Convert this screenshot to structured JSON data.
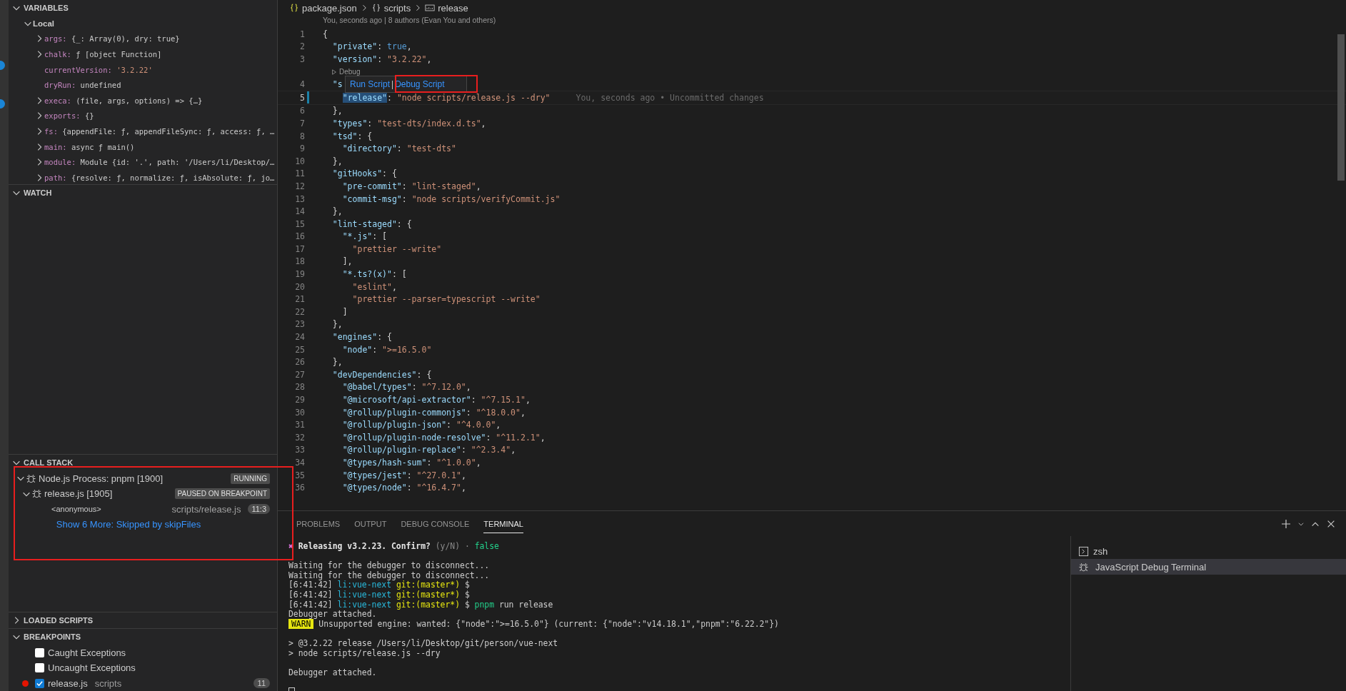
{
  "variables": {
    "title": "VARIABLES",
    "expanded": true,
    "scopes": [
      {
        "label": "Local",
        "expanded": true,
        "children": [
          {
            "name": "args:",
            "value": "{_: Array(0), dry: true}",
            "expandable": true,
            "kind": "object"
          },
          {
            "name": "chalk:",
            "value": "ƒ [object Function]",
            "expandable": true,
            "kind": "object"
          },
          {
            "name": "currentVersion:",
            "value": "'3.2.22'",
            "expandable": false,
            "kind": "string"
          },
          {
            "name": "dryRun:",
            "value": "undefined",
            "expandable": false,
            "kind": "object"
          },
          {
            "name": "execa:",
            "value": "(file, args, options) => {…}",
            "expandable": true,
            "kind": "object"
          },
          {
            "name": "exports:",
            "value": "{}",
            "expandable": true,
            "kind": "object"
          },
          {
            "name": "fs:",
            "value": "{appendFile: ƒ, appendFileSync: ƒ, access: ƒ, …",
            "expandable": true,
            "kind": "object"
          },
          {
            "name": "main:",
            "value": "async ƒ main()",
            "expandable": true,
            "kind": "object"
          },
          {
            "name": "module:",
            "value": "Module {id: '.', path: '/Users/li/Desktop/…",
            "expandable": true,
            "kind": "object"
          },
          {
            "name": "path:",
            "value": "{resolve: ƒ, normalize: ƒ, isAbsolute: ƒ, jo…",
            "expandable": true,
            "kind": "object"
          }
        ]
      }
    ]
  },
  "watch": {
    "title": "WATCH",
    "expanded": true
  },
  "call_stack": {
    "title": "CALL STACK",
    "expanded": true,
    "sessions": [
      {
        "label": "Node.js Process: pnpm [1900]",
        "status": "RUNNING",
        "expanded": true,
        "children": [
          {
            "label": "release.js [1905]",
            "status": "PAUSED ON BREAKPOINT",
            "expanded": true,
            "frames": [
              {
                "name": "<anonymous>",
                "file": "scripts/release.js",
                "position": "11:3"
              }
            ],
            "more": "Show 6 More: Skipped by skipFiles"
          }
        ]
      }
    ]
  },
  "loaded_scripts": {
    "title": "LOADED SCRIPTS",
    "expanded": false
  },
  "breakpoints": {
    "title": "BREAKPOINTS",
    "expanded": true,
    "items": [
      {
        "label": "Caught Exceptions",
        "checked": false,
        "kind": "exception"
      },
      {
        "label": "Uncaught Exceptions",
        "checked": false,
        "kind": "exception"
      },
      {
        "label": "release.js",
        "detail": "scripts",
        "count": "11",
        "checked": true,
        "kind": "file"
      }
    ]
  },
  "breadcrumb": [
    {
      "label": "package.json",
      "kind": "file"
    },
    {
      "label": "scripts",
      "kind": "object"
    },
    {
      "label": "release",
      "kind": "string"
    }
  ],
  "blame_header": "You, seconds ago | 8 authors (Evan You and others)",
  "hover_actions": {
    "items": [
      "Run Script",
      "Debug Script"
    ],
    "separator": "|"
  },
  "code": [
    {
      "kind": "code",
      "number": "1",
      "tokens": [
        {
          "kind": "punct",
          "text": "{"
        }
      ]
    },
    {
      "kind": "code",
      "number": "2",
      "tokens": [
        {
          "kind": "key",
          "text": "  \"private\""
        },
        {
          "kind": "punct",
          "text": ": "
        },
        {
          "kind": "bool",
          "text": "true"
        },
        {
          "kind": "punct",
          "text": ","
        }
      ]
    },
    {
      "kind": "code",
      "number": "3",
      "tokens": [
        {
          "kind": "key",
          "text": "  \"version\""
        },
        {
          "kind": "punct",
          "text": ": "
        },
        {
          "kind": "string",
          "text": "\"3.2.22\""
        },
        {
          "kind": "punct",
          "text": ","
        }
      ]
    },
    {
      "kind": "lens",
      "label": "Debug"
    },
    {
      "kind": "code",
      "number": "4",
      "tokens": [
        {
          "kind": "key",
          "text": "  \"s"
        }
      ]
    },
    {
      "kind": "code",
      "number": "5",
      "current": true,
      "modified": true,
      "tokens": [
        {
          "kind": "key-selected",
          "text": "    \"release\""
        },
        {
          "kind": "punct",
          "text": ": "
        },
        {
          "kind": "string",
          "text": "\"node scripts/release.js --dry\""
        }
      ],
      "blame": "You, seconds ago • Uncommitted changes"
    },
    {
      "kind": "code",
      "number": "6",
      "tokens": [
        {
          "kind": "punct",
          "text": "  },"
        }
      ]
    },
    {
      "kind": "code",
      "number": "7",
      "tokens": [
        {
          "kind": "key",
          "text": "  \"types\""
        },
        {
          "kind": "punct",
          "text": ": "
        },
        {
          "kind": "string",
          "text": "\"test-dts/index.d.ts\""
        },
        {
          "kind": "punct",
          "text": ","
        }
      ]
    },
    {
      "kind": "code",
      "number": "8",
      "tokens": [
        {
          "kind": "key",
          "text": "  \"tsd\""
        },
        {
          "kind": "punct",
          "text": ": {"
        }
      ]
    },
    {
      "kind": "code",
      "number": "9",
      "tokens": [
        {
          "kind": "key",
          "text": "    \"directory\""
        },
        {
          "kind": "punct",
          "text": ": "
        },
        {
          "kind": "string",
          "text": "\"test-dts\""
        }
      ]
    },
    {
      "kind": "code",
      "number": "10",
      "tokens": [
        {
          "kind": "punct",
          "text": "  },"
        }
      ]
    },
    {
      "kind": "code",
      "number": "11",
      "tokens": [
        {
          "kind": "key",
          "text": "  \"gitHooks\""
        },
        {
          "kind": "punct",
          "text": ": {"
        }
      ]
    },
    {
      "kind": "code",
      "number": "12",
      "tokens": [
        {
          "kind": "key",
          "text": "    \"pre-commit\""
        },
        {
          "kind": "punct",
          "text": ": "
        },
        {
          "kind": "string",
          "text": "\"lint-staged\""
        },
        {
          "kind": "punct",
          "text": ","
        }
      ]
    },
    {
      "kind": "code",
      "number": "13",
      "tokens": [
        {
          "kind": "key",
          "text": "    \"commit-msg\""
        },
        {
          "kind": "punct",
          "text": ": "
        },
        {
          "kind": "string",
          "text": "\"node scripts/verifyCommit.js\""
        }
      ]
    },
    {
      "kind": "code",
      "number": "14",
      "tokens": [
        {
          "kind": "punct",
          "text": "  },"
        }
      ]
    },
    {
      "kind": "code",
      "number": "15",
      "tokens": [
        {
          "kind": "key",
          "text": "  \"lint-staged\""
        },
        {
          "kind": "punct",
          "text": ": {"
        }
      ]
    },
    {
      "kind": "code",
      "number": "16",
      "tokens": [
        {
          "kind": "key",
          "text": "    \"*.js\""
        },
        {
          "kind": "punct",
          "text": ": ["
        }
      ]
    },
    {
      "kind": "code",
      "number": "17",
      "tokens": [
        {
          "kind": "string",
          "text": "      \"prettier --write\""
        }
      ]
    },
    {
      "kind": "code",
      "number": "18",
      "tokens": [
        {
          "kind": "punct",
          "text": "    ],"
        }
      ]
    },
    {
      "kind": "code",
      "number": "19",
      "tokens": [
        {
          "kind": "key",
          "text": "    \"*.ts?(x)\""
        },
        {
          "kind": "punct",
          "text": ": ["
        }
      ]
    },
    {
      "kind": "code",
      "number": "20",
      "tokens": [
        {
          "kind": "string",
          "text": "      \"eslint\""
        },
        {
          "kind": "punct",
          "text": ","
        }
      ]
    },
    {
      "kind": "code",
      "number": "21",
      "tokens": [
        {
          "kind": "string",
          "text": "      \"prettier --parser=typescript --write\""
        }
      ]
    },
    {
      "kind": "code",
      "number": "22",
      "tokens": [
        {
          "kind": "punct",
          "text": "    ]"
        }
      ]
    },
    {
      "kind": "code",
      "number": "23",
      "tokens": [
        {
          "kind": "punct",
          "text": "  },"
        }
      ]
    },
    {
      "kind": "code",
      "number": "24",
      "tokens": [
        {
          "kind": "key",
          "text": "  \"engines\""
        },
        {
          "kind": "punct",
          "text": ": {"
        }
      ]
    },
    {
      "kind": "code",
      "number": "25",
      "tokens": [
        {
          "kind": "key",
          "text": "    \"node\""
        },
        {
          "kind": "punct",
          "text": ": "
        },
        {
          "kind": "string",
          "text": "\">=16.5.0\""
        }
      ]
    },
    {
      "kind": "code",
      "number": "26",
      "tokens": [
        {
          "kind": "punct",
          "text": "  },"
        }
      ]
    },
    {
      "kind": "code",
      "number": "27",
      "tokens": [
        {
          "kind": "key",
          "text": "  \"devDependencies\""
        },
        {
          "kind": "punct",
          "text": ": {"
        }
      ]
    },
    {
      "kind": "code",
      "number": "28",
      "tokens": [
        {
          "kind": "key",
          "text": "    \"@babel/types\""
        },
        {
          "kind": "punct",
          "text": ": "
        },
        {
          "kind": "string",
          "text": "\"^7.12.0\""
        },
        {
          "kind": "punct",
          "text": ","
        }
      ]
    },
    {
      "kind": "code",
      "number": "29",
      "tokens": [
        {
          "kind": "key",
          "text": "    \"@microsoft/api-extractor\""
        },
        {
          "kind": "punct",
          "text": ": "
        },
        {
          "kind": "string",
          "text": "\"^7.15.1\""
        },
        {
          "kind": "punct",
          "text": ","
        }
      ]
    },
    {
      "kind": "code",
      "number": "30",
      "tokens": [
        {
          "kind": "key",
          "text": "    \"@rollup/plugin-commonjs\""
        },
        {
          "kind": "punct",
          "text": ": "
        },
        {
          "kind": "string",
          "text": "\"^18.0.0\""
        },
        {
          "kind": "punct",
          "text": ","
        }
      ]
    },
    {
      "kind": "code",
      "number": "31",
      "tokens": [
        {
          "kind": "key",
          "text": "    \"@rollup/plugin-json\""
        },
        {
          "kind": "punct",
          "text": ": "
        },
        {
          "kind": "string",
          "text": "\"^4.0.0\""
        },
        {
          "kind": "punct",
          "text": ","
        }
      ]
    },
    {
      "kind": "code",
      "number": "32",
      "tokens": [
        {
          "kind": "key",
          "text": "    \"@rollup/plugin-node-resolve\""
        },
        {
          "kind": "punct",
          "text": ": "
        },
        {
          "kind": "string",
          "text": "\"^11.2.1\""
        },
        {
          "kind": "punct",
          "text": ","
        }
      ]
    },
    {
      "kind": "code",
      "number": "33",
      "tokens": [
        {
          "kind": "key",
          "text": "    \"@rollup/plugin-replace\""
        },
        {
          "kind": "punct",
          "text": ": "
        },
        {
          "kind": "string",
          "text": "\"^2.3.4\""
        },
        {
          "kind": "punct",
          "text": ","
        }
      ]
    },
    {
      "kind": "code",
      "number": "34",
      "tokens": [
        {
          "kind": "key",
          "text": "    \"@types/hash-sum\""
        },
        {
          "kind": "punct",
          "text": ": "
        },
        {
          "kind": "string",
          "text": "\"^1.0.0\""
        },
        {
          "kind": "punct",
          "text": ","
        }
      ]
    },
    {
      "kind": "code",
      "number": "35",
      "tokens": [
        {
          "kind": "key",
          "text": "    \"@types/jest\""
        },
        {
          "kind": "punct",
          "text": ": "
        },
        {
          "kind": "string",
          "text": "\"^27.0.1\""
        },
        {
          "kind": "punct",
          "text": ","
        }
      ]
    },
    {
      "kind": "code",
      "number": "36",
      "tokens": [
        {
          "kind": "key",
          "text": "    \"@types/node\""
        },
        {
          "kind": "punct",
          "text": ": "
        },
        {
          "kind": "string",
          "text": "\"^16.4.7\""
        },
        {
          "kind": "punct",
          "text": ","
        }
      ]
    }
  ],
  "panel_tabs": [
    {
      "label": "PROBLEMS",
      "selected": false
    },
    {
      "label": "OUTPUT",
      "selected": false
    },
    {
      "label": "DEBUG CONSOLE",
      "selected": false
    },
    {
      "label": "TERMINAL",
      "selected": true
    }
  ],
  "terminal": {
    "lines": [
      {
        "segments": [
          {
            "kind": "pink",
            "text": "✖ "
          },
          {
            "kind": "bold",
            "text": "Releasing v3.2.23. Confirm?"
          },
          {
            "kind": "dim",
            "text": " (y/N) · "
          },
          {
            "kind": "green",
            "text": "false"
          }
        ]
      },
      {
        "spaced": true,
        "segments": [
          {
            "kind": "plain",
            "text": "Waiting for the debugger to disconnect..."
          }
        ]
      },
      {
        "segments": [
          {
            "kind": "plain",
            "text": "Waiting for the debugger to disconnect..."
          }
        ]
      },
      {
        "segments": [
          {
            "kind": "plain",
            "text": "[6:41:42] "
          },
          {
            "kind": "cyan",
            "text": "li:vue-next "
          },
          {
            "kind": "yellow",
            "text": "git:(master*)"
          },
          {
            "kind": "plain",
            "text": " $"
          }
        ]
      },
      {
        "segments": [
          {
            "kind": "plain",
            "text": "[6:41:42] "
          },
          {
            "kind": "cyan",
            "text": "li:vue-next "
          },
          {
            "kind": "yellow",
            "text": "git:(master*)"
          },
          {
            "kind": "plain",
            "text": " $"
          }
        ]
      },
      {
        "segments": [
          {
            "kind": "plain",
            "text": "[6:41:42] "
          },
          {
            "kind": "cyan",
            "text": "li:vue-next "
          },
          {
            "kind": "yellow",
            "text": "git:(master*)"
          },
          {
            "kind": "plain",
            "text": " $ "
          },
          {
            "kind": "green",
            "text": "pnpm"
          },
          {
            "kind": "plain",
            "text": " run release"
          }
        ]
      },
      {
        "segments": [
          {
            "kind": "plain",
            "text": "Debugger attached."
          }
        ]
      },
      {
        "segments": [
          {
            "kind": "warn",
            "text": "WARN"
          },
          {
            "kind": "plain",
            "text": " Unsupported engine: wanted: {\"node\":\">=16.5.0\"} (current: {\"node\":\"v14.18.1\",\"pnpm\":\"6.22.2\"})"
          }
        ]
      },
      {
        "spaced": true,
        "segments": [
          {
            "kind": "plain",
            "text": "> @3.2.22 release /Users/li/Desktop/git/person/vue-next"
          }
        ]
      },
      {
        "segments": [
          {
            "kind": "plain",
            "text": "> node scripts/release.js --dry"
          }
        ]
      },
      {
        "spaced": true,
        "segments": [
          {
            "kind": "plain",
            "text": "Debugger attached."
          }
        ]
      }
    ],
    "cursor": true,
    "sessions": [
      {
        "label": "zsh",
        "kind": "shell",
        "selected": false
      },
      {
        "label": "JavaScript Debug Terminal",
        "kind": "debug",
        "selected": true
      }
    ]
  }
}
